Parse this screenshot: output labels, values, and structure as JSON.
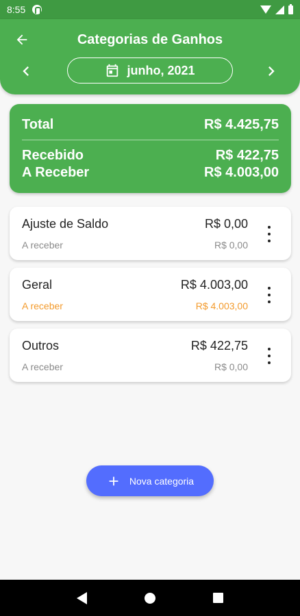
{
  "status_bar": {
    "time": "8:55"
  },
  "header": {
    "title": "Categorias de Ganhos",
    "month": "junho, 2021"
  },
  "summary": {
    "total_label": "Total",
    "total_value": "R$ 4.425,75",
    "recebido_label": "Recebido",
    "recebido_value": "R$ 422,75",
    "areceber_label": "A Receber",
    "areceber_value": "R$ 4.003,00"
  },
  "categories": [
    {
      "name": "Ajuste de Saldo",
      "amount": "R$ 0,00",
      "sub_label": "A receber",
      "sub_amount": "R$ 0,00"
    },
    {
      "name": "Geral",
      "amount": "R$ 4.003,00",
      "sub_label": "A receber",
      "sub_amount": "R$ 4.003,00"
    },
    {
      "name": "Outros",
      "amount": "R$ 422,75",
      "sub_label": "A receber",
      "sub_amount": "R$ 0,00"
    }
  ],
  "fab": {
    "label": "Nova categoria"
  },
  "colors": {
    "primary": "#4caf50",
    "status_bar": "#3f9a42",
    "accent": "#536dfe",
    "pending": "#f39a2b"
  },
  "icons": {
    "back": "arrow-left-icon",
    "prev": "chevron-left-icon",
    "next": "chevron-right-icon",
    "calendar": "calendar-icon",
    "menu": "more-vert-icon",
    "add": "plus-icon"
  }
}
